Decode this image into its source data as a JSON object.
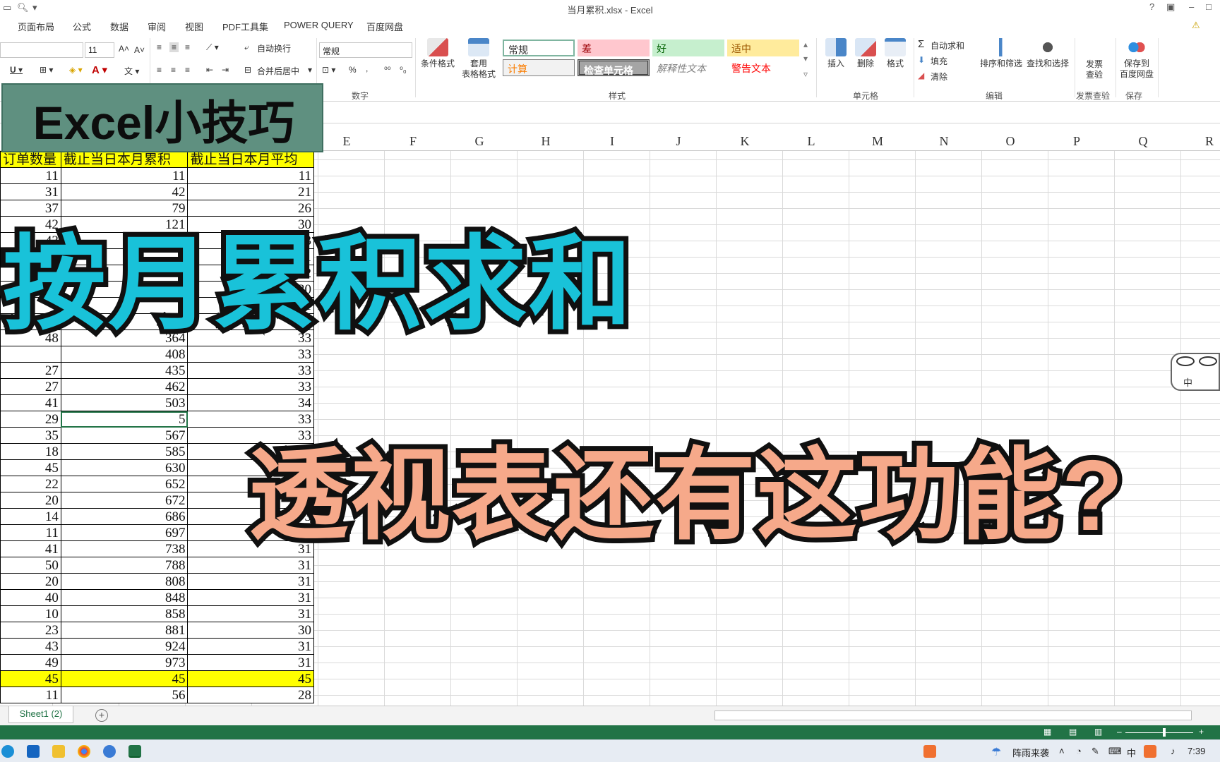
{
  "window": {
    "title": "当月累积.xlsx - Excel",
    "help": "?",
    "minimize": "–",
    "maximize": "□",
    "close": "✕"
  },
  "tabs": [
    "页面布局",
    "公式",
    "数据",
    "审阅",
    "视图",
    "PDF工具集",
    "POWER QUERY",
    "百度网盘"
  ],
  "ribbon": {
    "font_size": "11",
    "wrap_text": "自动换行",
    "merge_center": "合并后居中",
    "number_format": "常规",
    "percent": "%",
    "comma": ",",
    "group_number": "数字",
    "conditional_format": "条件格式",
    "table_format_1": "套用",
    "table_format_2": "表格格式",
    "styles": {
      "normal": "常规",
      "bad": "差",
      "good": "好",
      "neutral": "适中",
      "calculation": "计算",
      "check_cell": "检查单元格",
      "explanatory": "解释性文本",
      "warning": "警告文本"
    },
    "group_styles": "样式",
    "insert": "插入",
    "delete": "删除",
    "format": "格式",
    "group_cells": "单元格",
    "autosum": "自动求和",
    "fill": "填充",
    "clear": "清除",
    "sort_filter": "排序和筛选",
    "find_select": "查找和选择",
    "group_editing": "编辑",
    "invoice_1": "发票",
    "invoice_2": "查验",
    "group_invoice": "发票查验",
    "save_baidu_1": "保存到",
    "save_baidu_2": "百度网盘",
    "group_save": "保存"
  },
  "columns": [
    "E",
    "F",
    "G",
    "H",
    "I",
    "J",
    "K",
    "L",
    "M",
    "N",
    "O",
    "P",
    "Q",
    "R"
  ],
  "table": {
    "headers": [
      "订单数量",
      "截止当日本月累积",
      "截止当日本月平均"
    ],
    "rows": [
      [
        "11",
        "11",
        "11"
      ],
      [
        "31",
        "42",
        "21"
      ],
      [
        "37",
        "79",
        "26"
      ],
      [
        "42",
        "121",
        "30"
      ],
      [
        "43",
        "164",
        "33"
      ],
      [
        "22",
        "",
        "31"
      ],
      [
        "",
        "",
        "32"
      ],
      [
        "",
        "",
        "30"
      ],
      [
        "",
        "",
        "31"
      ],
      [
        "",
        "",
        "32"
      ],
      [
        "48",
        "364",
        "33"
      ],
      [
        "",
        "408",
        "33"
      ],
      [
        "27",
        "435",
        "33"
      ],
      [
        "27",
        "462",
        "33"
      ],
      [
        "41",
        "503",
        "34"
      ],
      [
        "29",
        "5",
        "33"
      ],
      [
        "35",
        "567",
        "33"
      ],
      [
        "18",
        "585",
        "33"
      ],
      [
        "45",
        "630",
        "33"
      ],
      [
        "22",
        "652",
        "33"
      ],
      [
        "20",
        "672",
        "33"
      ],
      [
        "14",
        "686",
        "3"
      ],
      [
        "11",
        "697",
        "30"
      ],
      [
        "41",
        "738",
        "31"
      ],
      [
        "50",
        "788",
        "31"
      ],
      [
        "20",
        "808",
        "31"
      ],
      [
        "40",
        "848",
        "31"
      ],
      [
        "10",
        "858",
        "31"
      ],
      [
        "23",
        "881",
        "30"
      ],
      [
        "43",
        "924",
        "31"
      ],
      [
        "49",
        "973",
        "31"
      ],
      [
        "45",
        "45",
        "45"
      ],
      [
        "11",
        "56",
        "28"
      ]
    ],
    "highlight_row": 31,
    "active_row": 15
  },
  "overlay": {
    "badge": "Excel小技巧",
    "headline_1": "按月累积求和",
    "headline_2": "透视表还有这功能?"
  },
  "ime": {
    "label": "中"
  },
  "sheet": {
    "tab": "Sheet1 (2)",
    "add": "+"
  },
  "taskbar": {
    "weather": "阵雨来袭",
    "ime": "中",
    "time": "7:39"
  },
  "colors": {
    "excel_green": "#217346",
    "highlight_yellow": "#ffff00",
    "headline_cyan": "#19c2d9",
    "headline_salmon": "#f6a98a",
    "badge_teal": "#5f9080"
  }
}
